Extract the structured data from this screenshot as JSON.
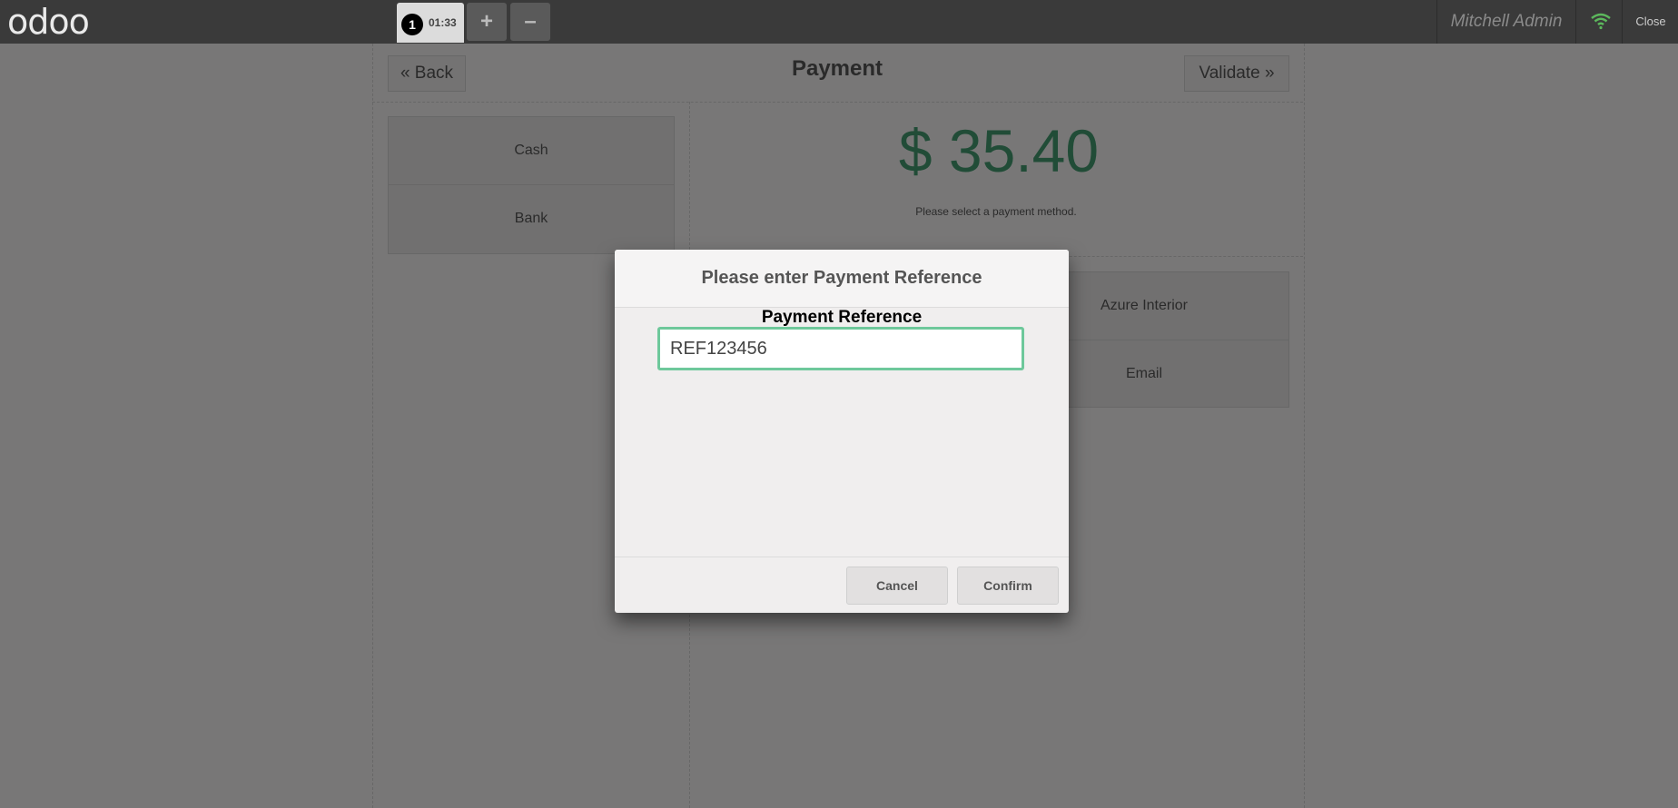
{
  "topbar": {
    "logo": "odoo",
    "order_number": "1",
    "order_time": "01:33",
    "add_order_icon": "plus-icon",
    "remove_order_icon": "minus-icon",
    "user_name": "Mitchell Admin",
    "network_icon": "wifi-icon",
    "close_label": "Close",
    "wifi_color": "#5cb85c"
  },
  "payment": {
    "back_label": "Back",
    "title": "Payment",
    "validate_label": "Validate",
    "methods": [
      {
        "label": "Cash"
      },
      {
        "label": "Bank"
      }
    ],
    "total": "$ 35.40",
    "message": "Please select a payment method.",
    "customer_label": "Azure Interior",
    "email_label": "Email",
    "total_color": "#43996e"
  },
  "modal": {
    "title": "Please enter Payment Reference",
    "field_label": "Payment Reference",
    "input_value": "REF123456",
    "cancel_label": "Cancel",
    "confirm_label": "Confirm",
    "focus_color": "#6ec89b"
  }
}
